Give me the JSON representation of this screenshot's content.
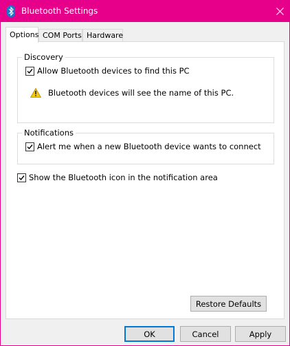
{
  "window": {
    "title": "Bluetooth Settings",
    "accent_color": "#e6008a",
    "title_icon": "bluetooth-icon",
    "close_icon": "close-icon"
  },
  "tabs": [
    {
      "label": "Options",
      "active": true
    },
    {
      "label": "COM Ports",
      "active": false
    },
    {
      "label": "Hardware",
      "active": false
    }
  ],
  "discovery": {
    "legend": "Discovery",
    "allow_label": "Allow Bluetooth devices to find this PC",
    "allow_checked": true,
    "warning_icon": "warning-icon",
    "warning_text": "Bluetooth devices will see the name of this PC."
  },
  "notifications": {
    "legend": "Notifications",
    "alert_label": "Alert me when a new Bluetooth device wants to connect",
    "alert_checked": true
  },
  "show_icon": {
    "label": "Show the Bluetooth icon in the notification area",
    "checked": true
  },
  "buttons": {
    "restore_defaults": "Restore Defaults",
    "ok": "OK",
    "cancel": "Cancel",
    "apply": "Apply"
  }
}
